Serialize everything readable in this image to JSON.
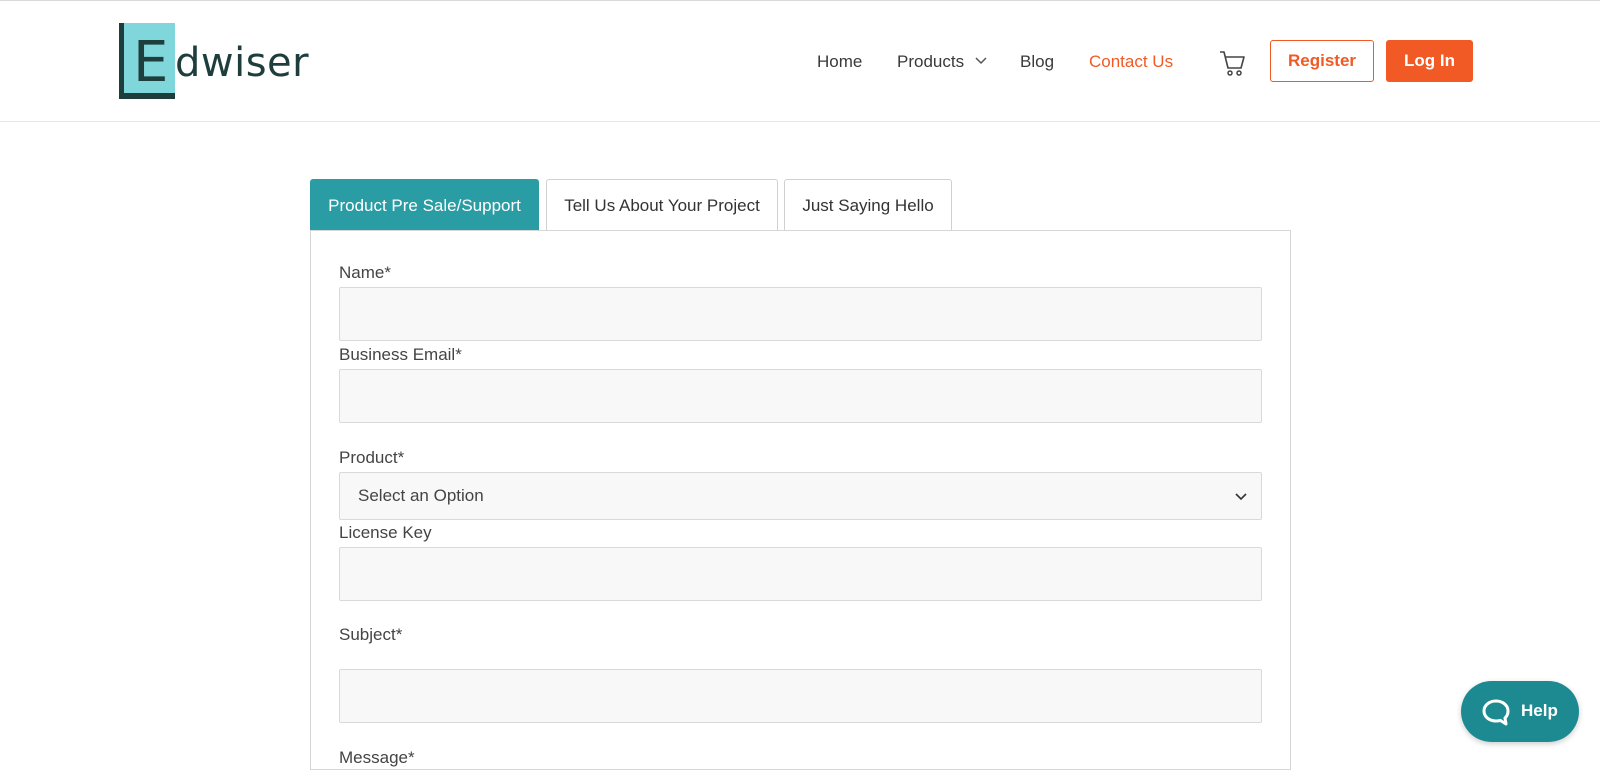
{
  "brand": {
    "logo_text": "Edwiser",
    "logo_letter": "E",
    "logo_word": "dwiser"
  },
  "nav": {
    "home": "Home",
    "products": "Products",
    "blog": "Blog",
    "contact": "Contact Us"
  },
  "header_buttons": {
    "register": "Register",
    "login": "Log In"
  },
  "tabs": [
    {
      "label": "Product Pre Sale/Support",
      "active": true
    },
    {
      "label": "Tell Us About Your Project",
      "active": false
    },
    {
      "label": "Just Saying Hello",
      "active": false
    }
  ],
  "form": {
    "name_label": "Name*",
    "email_label": "Business Email*",
    "product_label": "Product*",
    "product_value": "Select an Option",
    "license_label": "License Key",
    "subject_label": "Subject*",
    "message_label": "Message*"
  },
  "help_button": {
    "label": "Help"
  },
  "colors": {
    "accent": "#f15a24",
    "tab_active": "#2a9ca4",
    "help_bg": "#1d8a91",
    "logo_book": "#7fd6db"
  }
}
